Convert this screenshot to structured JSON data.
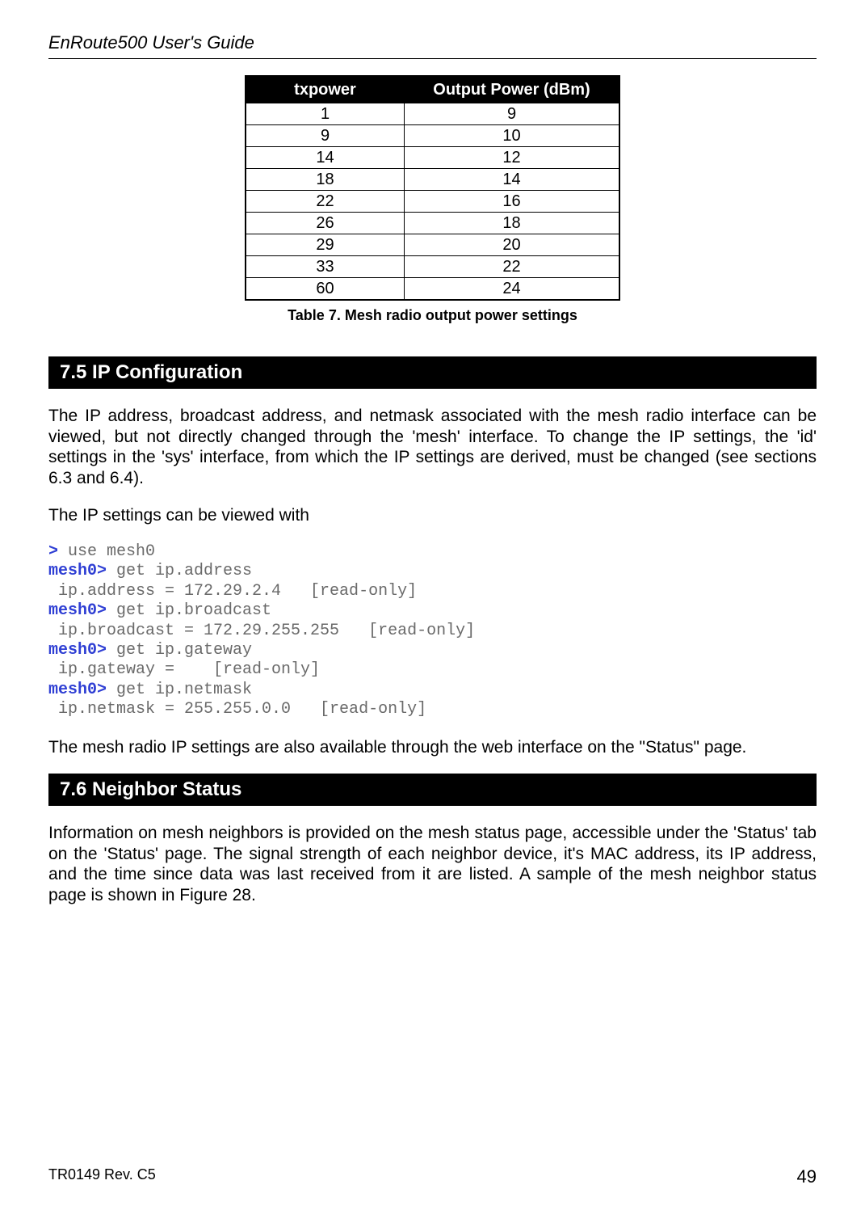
{
  "header": {
    "title": "EnRoute500 User's Guide"
  },
  "chart_data": {
    "type": "table",
    "title": "Table 7.  Mesh radio output power settings",
    "headers": [
      "txpower",
      "Output Power (dBm)"
    ],
    "rows": [
      [
        "1",
        "9"
      ],
      [
        "9",
        "10"
      ],
      [
        "14",
        "12"
      ],
      [
        "18",
        "14"
      ],
      [
        "22",
        "16"
      ],
      [
        "26",
        "18"
      ],
      [
        "29",
        "20"
      ],
      [
        "33",
        "22"
      ],
      [
        "60",
        "24"
      ]
    ]
  },
  "section_75": {
    "title": "7.5      IP Configuration"
  },
  "para1": "The IP address, broadcast address, and netmask associated with the mesh radio interface can be viewed, but not directly changed through the 'mesh' interface. To change the IP settings, the 'id' settings in the 'sys' interface, from which the IP settings are derived, must be changed (see sections 6.3 and 6.4).",
  "para2": "The IP settings can be viewed with",
  "code": {
    "l1p": ">",
    "l1c": " use mesh0",
    "l2p": "mesh0>",
    "l2c": " get ip.address",
    "l3": " ip.address = 172.29.2.4   [read-only]",
    "l4p": "mesh0>",
    "l4c": " get ip.broadcast",
    "l5": " ip.broadcast = 172.29.255.255   [read-only]",
    "l6p": "mesh0>",
    "l6c": " get ip.gateway",
    "l7": " ip.gateway =    [read-only]",
    "l8p": "mesh0>",
    "l8c": " get ip.netmask",
    "l9": " ip.netmask = 255.255.0.0   [read-only]"
  },
  "para3": "The mesh radio IP settings are also available through the web interface on the \"Status\" page.",
  "section_76": {
    "title": "7.6      Neighbor Status"
  },
  "para4": "Information on mesh neighbors is provided on the mesh status page, accessible under the 'Status' tab on the 'Status' page. The signal strength of each neighbor device, it's MAC address, its IP address, and the time since data was last received from it are listed. A sample of the mesh neighbor status page is shown in Figure 28.",
  "footer": {
    "left": "TR0149 Rev. C5",
    "right": "49"
  }
}
